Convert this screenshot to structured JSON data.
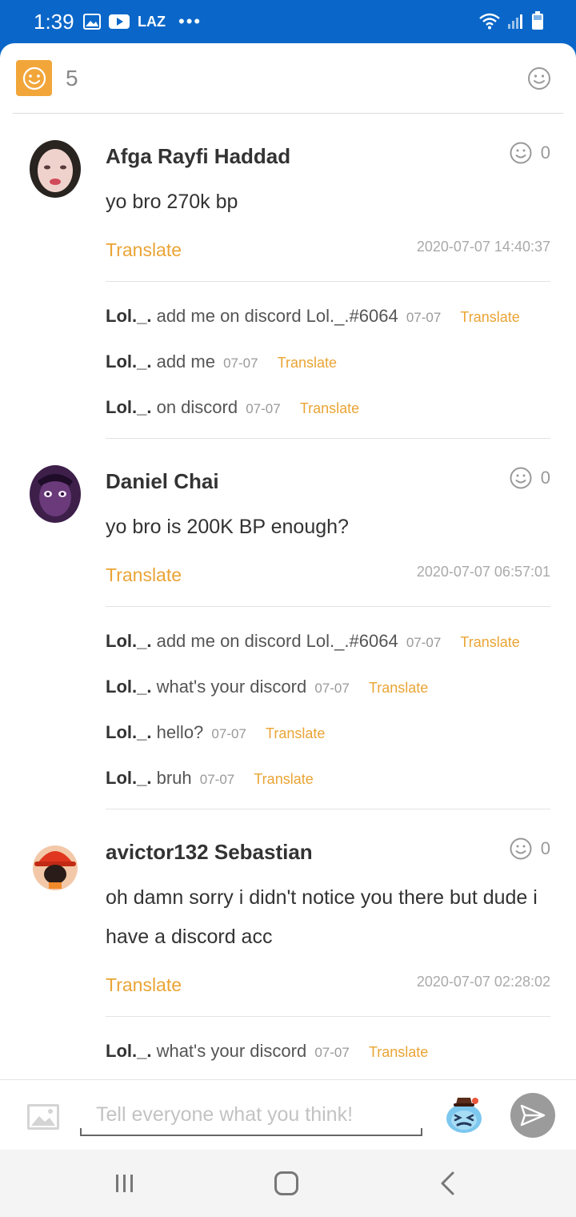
{
  "status_bar": {
    "time": "1:39",
    "icons_left": [
      "image-icon",
      "youtube-icon",
      "laz-icon",
      "more-dots-icon"
    ],
    "laz_label": "LAZ",
    "dots": "•••",
    "icons_right": [
      "wifi-icon",
      "signal-icon",
      "battery-icon"
    ]
  },
  "header": {
    "reaction_count": "5"
  },
  "comments": [
    {
      "author": "Afga Rayfi Haddad",
      "text": "yo bro 270k bp",
      "translate_label": "Translate",
      "timestamp": "2020-07-07 14:40:37",
      "reaction_count": "0",
      "replies": [
        {
          "author": "Lol._.",
          "text": "add me on discord Lol._.#6064",
          "date": "07-07",
          "translate_label": "Translate"
        },
        {
          "author": "Lol._.",
          "text": "add me",
          "date": "07-07",
          "translate_label": "Translate"
        },
        {
          "author": "Lol._.",
          "text": "on discord",
          "date": "07-07",
          "translate_label": "Translate"
        }
      ]
    },
    {
      "author": "Daniel Chai",
      "text": "yo bro is 200K BP enough?",
      "translate_label": "Translate",
      "timestamp": "2020-07-07 06:57:01",
      "reaction_count": "0",
      "replies": [
        {
          "author": "Lol._.",
          "text": "add me on discord Lol._.#6064",
          "date": "07-07",
          "translate_label": "Translate"
        },
        {
          "author": "Lol._.",
          "text": "what's your discord",
          "date": "07-07",
          "translate_label": "Translate"
        },
        {
          "author": "Lol._.",
          "text": "hello?",
          "date": "07-07",
          "translate_label": "Translate"
        },
        {
          "author": "Lol._.",
          "text": "bruh",
          "date": "07-07",
          "translate_label": "Translate"
        }
      ]
    },
    {
      "author": "avictor132 Sebastian",
      "text": "oh damn sorry i didn't notice you there but dude i have a discord acc",
      "translate_label": "Translate",
      "timestamp": "2020-07-07 02:28:02",
      "reaction_count": "0",
      "replies": [
        {
          "author": "Lol._.",
          "text": "what's your discord",
          "date": "07-07",
          "translate_label": "Translate"
        }
      ]
    }
  ],
  "input": {
    "placeholder": "Tell everyone what you think!",
    "value": ""
  },
  "colors": {
    "status_bar": "#0a67c9",
    "accent": "#f2a63a",
    "translate": "#eaa435",
    "send_button": "#9b9b9b"
  },
  "icons": {
    "header_react": "smiley-icon",
    "comment_react": "smiley-icon",
    "attach": "image-icon",
    "sticker": "sticker-icon",
    "send": "send-icon",
    "nav": [
      "recents-icon",
      "home-icon",
      "back-icon"
    ]
  }
}
